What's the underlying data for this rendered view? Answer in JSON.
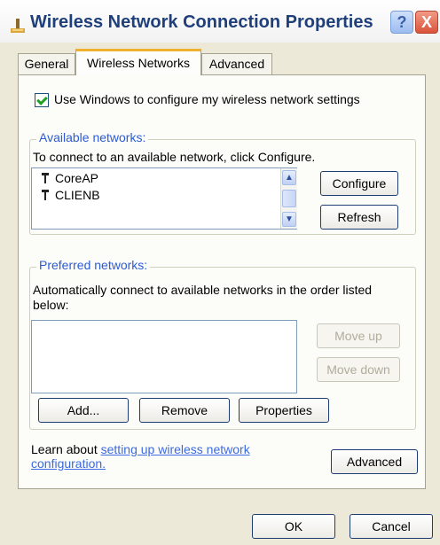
{
  "title": "Wireless Network Connection Properties",
  "titlebar": {
    "help_label": "?",
    "close_label": "X"
  },
  "tabs": [
    {
      "label": "General"
    },
    {
      "label": "Wireless Networks"
    },
    {
      "label": "Advanced"
    }
  ],
  "use_windows_checkbox": {
    "label": "Use Windows to configure my wireless network settings",
    "checked": true
  },
  "available": {
    "legend": "Available networks:",
    "instructions": "To connect to an available network, click Configure.",
    "networks": [
      "CoreAP",
      "CLIENB"
    ],
    "configure_label": "Configure",
    "refresh_label": "Refresh"
  },
  "preferred": {
    "legend": "Preferred networks:",
    "instructions_line1": "Automatically connect to available networks in the order listed",
    "instructions_line2": "below:",
    "move_up_label": "Move up",
    "move_down_label": "Move down",
    "add_label": "Add...",
    "remove_label": "Remove",
    "properties_label": "Properties"
  },
  "learn": {
    "prefix": "Learn about ",
    "link_line1": "setting up wireless network",
    "link_line2": "configuration."
  },
  "advanced_label": "Advanced",
  "ok_label": "OK",
  "cancel_label": "Cancel",
  "icons": {
    "title": "network-connection-icon",
    "network": "antenna-icon"
  }
}
